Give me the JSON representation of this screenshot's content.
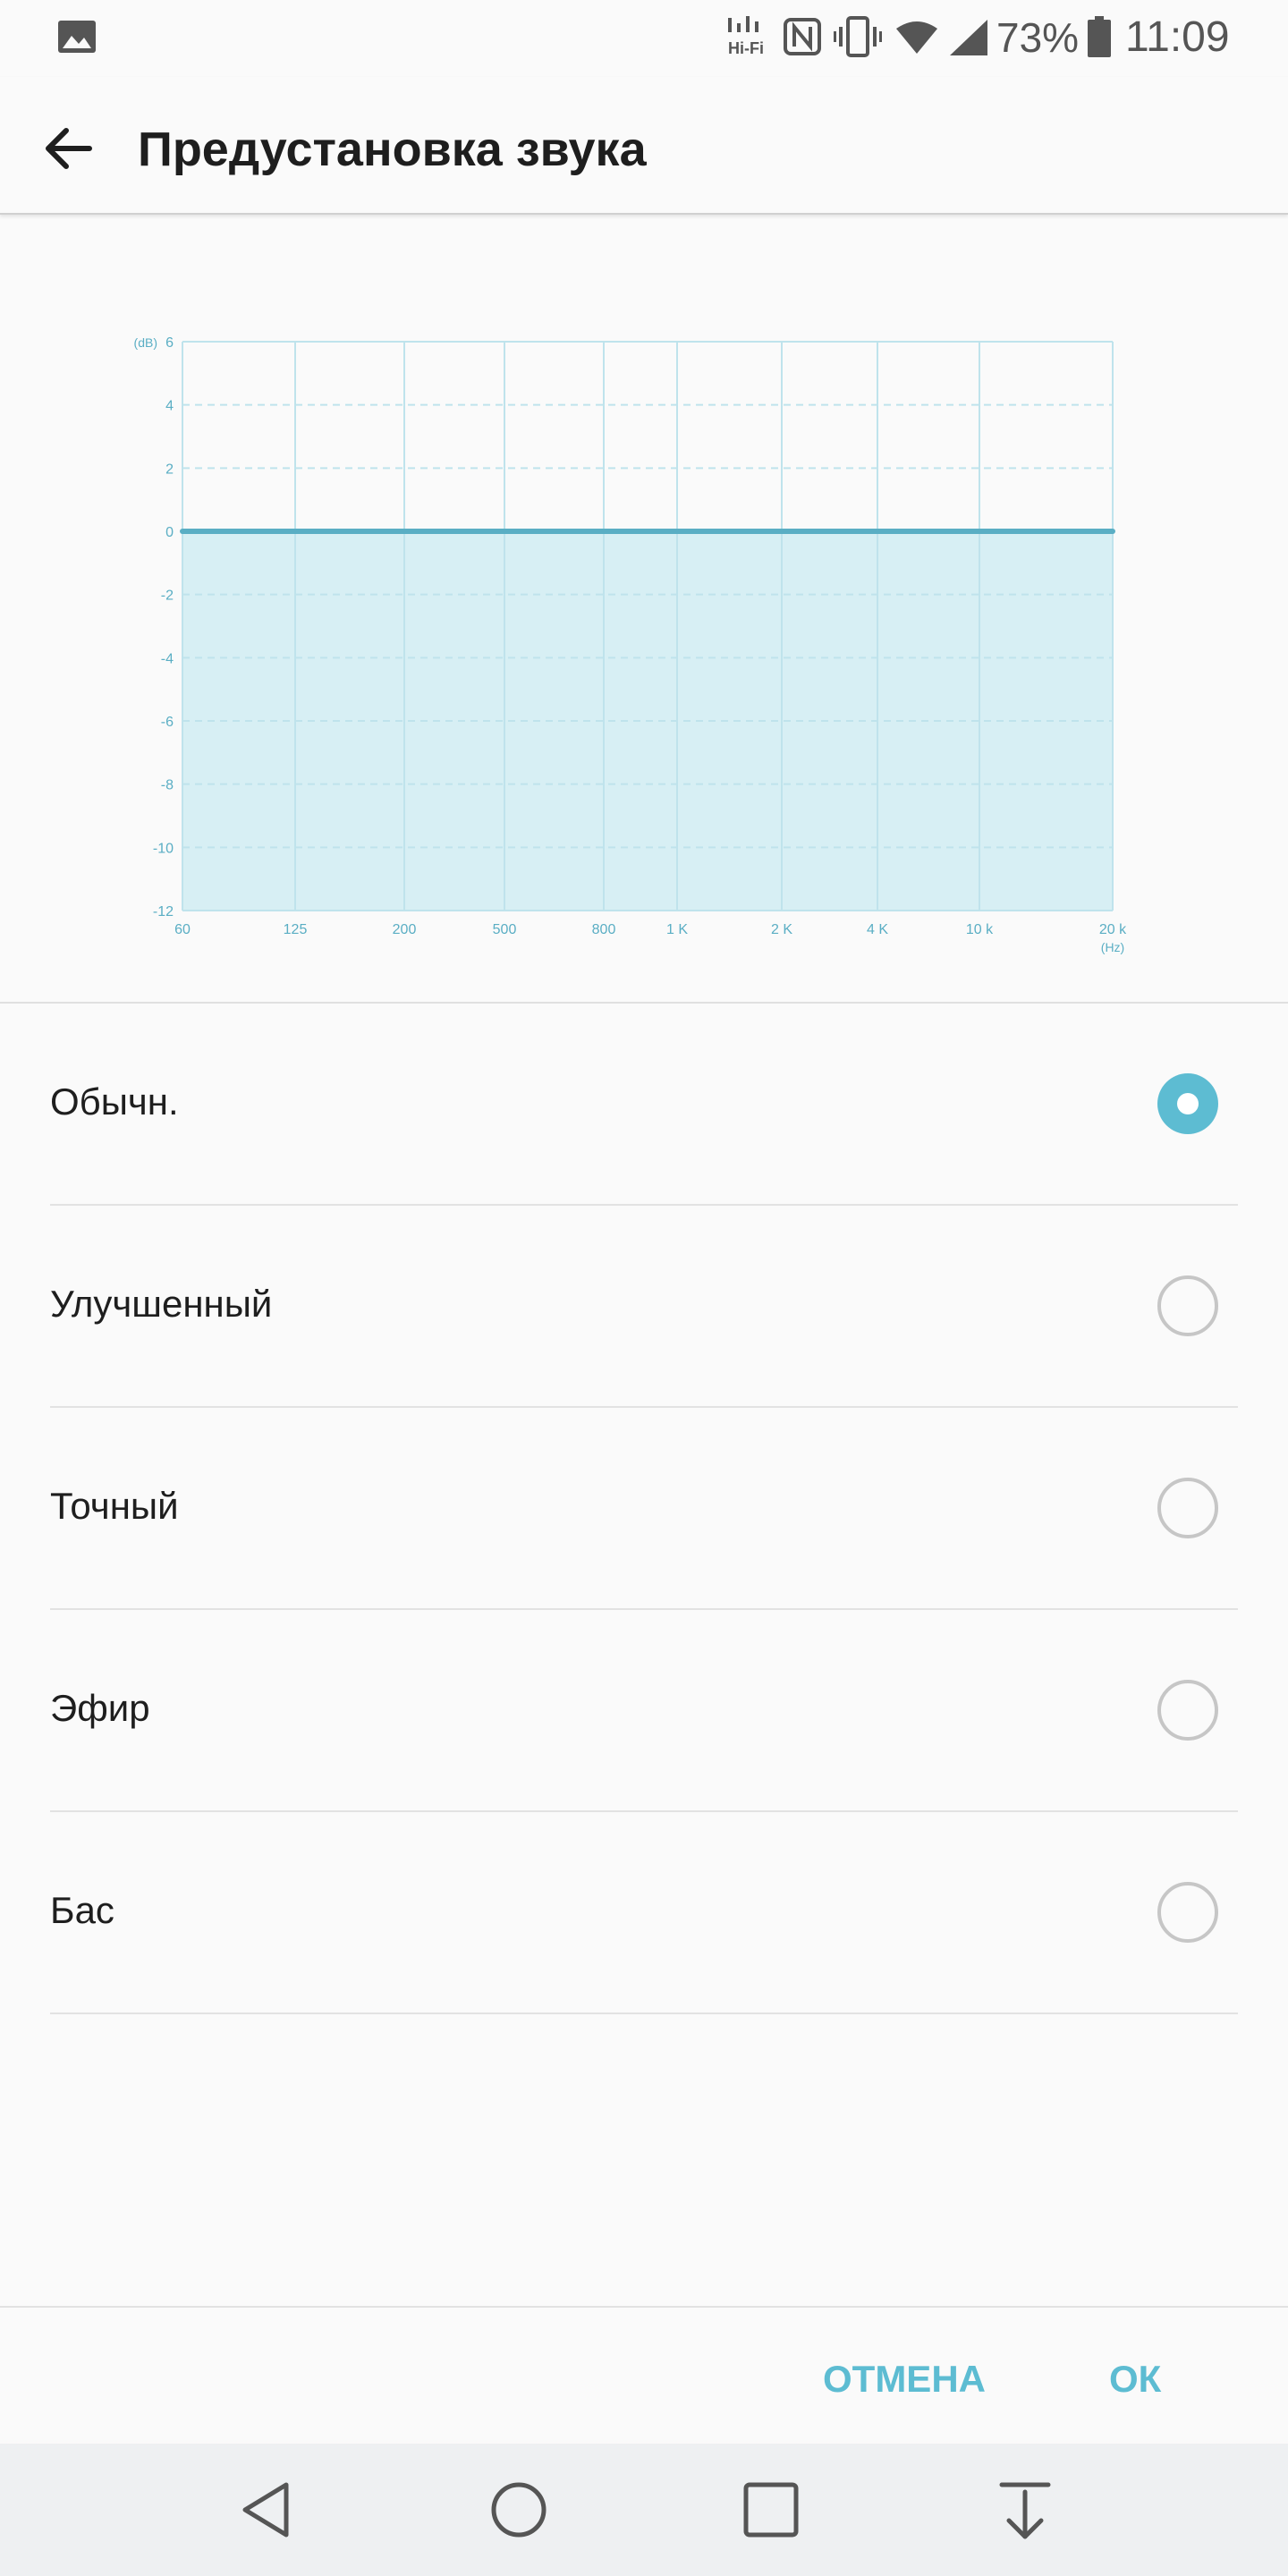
{
  "status_bar": {
    "battery_percent": "73%",
    "time": "11:09",
    "icons": [
      "gallery-icon",
      "hifi-icon",
      "nfc-icon",
      "vibrate-icon",
      "wifi-icon",
      "signal-icon",
      "battery-icon"
    ]
  },
  "app_bar": {
    "title": "Предустановка звука",
    "back_icon": "arrow-back-icon"
  },
  "chart_data": {
    "type": "line",
    "y_unit": "(dB)",
    "x_unit": "(Hz)",
    "y_ticks": [
      "6",
      "4",
      "2",
      "0",
      "-2",
      "-4",
      "-6",
      "-8",
      "-10",
      "-12"
    ],
    "x_ticks": [
      "60",
      "125",
      "200",
      "500",
      "800",
      "1 K",
      "2 K",
      "4 K",
      "10 k",
      "20 k"
    ],
    "ylim": [
      -12,
      6
    ],
    "series": [
      {
        "values": [
          0,
          0,
          0,
          0,
          0,
          0,
          0,
          0,
          0,
          0
        ]
      }
    ],
    "colors": {
      "line": "#5aaec4",
      "fill": "#d7eff4",
      "grid": "#bfe3ec",
      "labels": "#5aaec4"
    },
    "grid": true
  },
  "presets": [
    {
      "label": "Обычн.",
      "selected": true
    },
    {
      "label": "Улучшенный",
      "selected": false
    },
    {
      "label": "Точный",
      "selected": false
    },
    {
      "label": "Эфир",
      "selected": false
    },
    {
      "label": "Бас",
      "selected": false
    }
  ],
  "footer": {
    "cancel_label": "ОТМЕНА",
    "ok_label": "ОК"
  },
  "nav_bar": {
    "icons": [
      "back-triangle-icon",
      "home-circle-icon",
      "recents-square-icon",
      "notifications-down-icon"
    ]
  },
  "colors": {
    "accent": "#5dbcd2"
  }
}
